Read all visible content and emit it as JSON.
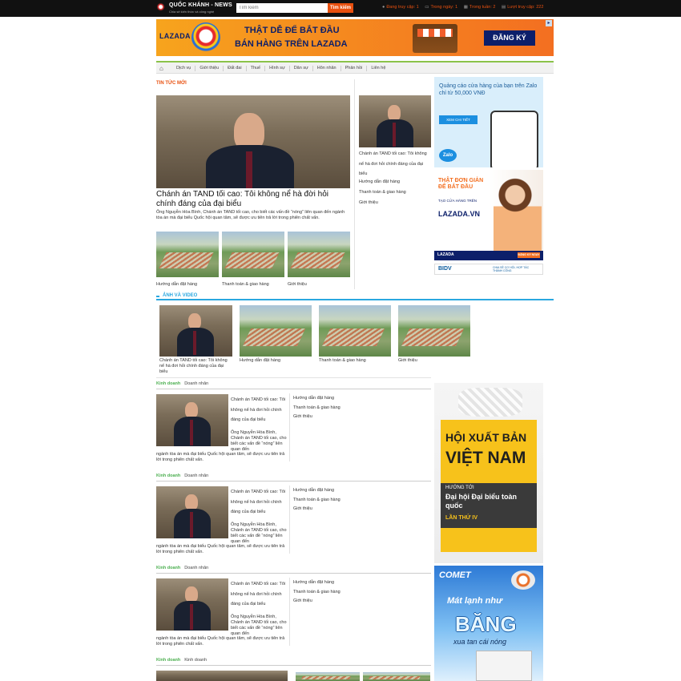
{
  "header": {
    "logo_name": "QUỐC KHÁNH - NEWS",
    "logo_tagline": "Chia sẻ kiến thức và công nghệ",
    "search_placeholder": "Tìm kiếm",
    "search_button": "Tìm kiếm",
    "stats": [
      {
        "label": "Đang truy cập:",
        "value": "1"
      },
      {
        "label": "Trong ngày:",
        "value": "1"
      },
      {
        "label": "Trong tuần:",
        "value": "2"
      },
      {
        "label": "Lượt truy cập:",
        "value": "222"
      }
    ]
  },
  "banner": {
    "brand": "LAZADA",
    "line1": "THẬT DỄ ĐỂ BẮT ĐẦU",
    "line2": "BÁN HÀNG TRÊN LAZADA",
    "cta": "ĐĂNG KÝ"
  },
  "nav": {
    "items": [
      "Dịch vụ",
      "Giới thiệu",
      "Đất đai",
      "Thuế",
      "Hình sự",
      "Dân sự",
      "Hôn nhân",
      "Phản hồi",
      "Liên hệ"
    ]
  },
  "latest": {
    "section_title": "TIN TỨC MỚI",
    "main_title": "Chánh án TAND tối cao: Tôi không nể hà đời hỏi chính đáng của đại biểu",
    "main_summary": "Ông Nguyễn Hòa Bình, Chánh án TAND tối cao, cho biết các vấn đề “nóng” liên quan đến ngành tòa án mà đại biểu Quốc hội quan tâm, sẽ được ưu tiên trả lời trong phiên chất vấn.",
    "thumbs": [
      "Hướng dẫn đặt hàng",
      "Thanh toán & giao hàng",
      "Giới thiệu"
    ],
    "side_caption": "Chánh án TAND tối cao: Tôi không nể hà đơi hỏi chính đáng của đại biểu",
    "side_links": [
      "Hướng dẫn đặt hàng",
      "Thanh toán & giao hàng",
      "Giới thiệu"
    ]
  },
  "video": {
    "section_title": "ẢNH VÀ VIDEO",
    "items": [
      "Chánh án TAND tối cao: Tôi không nể hà đơi hỏi chính đáng của đại biểu",
      "Hướng dẫn đặt hàng",
      "Thanh toán & giao hàng",
      "Giới thiệu"
    ]
  },
  "categories": [
    {
      "title": "Kinh doanh",
      "sub": "Doanh nhân"
    },
    {
      "title": "Kinh doanh",
      "sub": "Doanh nhân"
    },
    {
      "title": "Kinh doanh",
      "sub": "Doanh nhân"
    },
    {
      "title": "Kinh doanh",
      "sub": "Kinh doanh"
    }
  ],
  "category_block": {
    "title": "Chánh án TAND tối cao: Tôi không nể hà đơi hỏi chính đáng của đại biểu",
    "summary_short": "Ông Nguyễn Hòa Bình, Chánh án TAND tối cao, cho biết các vấn đề “nóng” liên quan đến",
    "summary_rest": "ngành tòa án mà đại biểu Quốc hội quan tâm, sẽ được ưu tiên trả lời trong phiên chất vấn.",
    "links": [
      "Hướng dẫn đặt hàng",
      "Thanh toán & giao hàng",
      "Giới thiệu"
    ]
  },
  "ads": {
    "zalo_text": "Quảng cáo cửa hàng của bạn trên Zalo chỉ từ 50,000 VNĐ",
    "zalo_button": "XEM CHI TIẾT",
    "zalo_logo": "Zalo",
    "lazada_t1": "THẬT ĐƠN GIẢN ĐỂ BẮT ĐẦU",
    "lazada_t2": "TẠO CỬA HÀNG TRÊN",
    "lazada_t3": "LAZADA.VN",
    "lazada_foot": "LAZADA",
    "lazada_cta": "ĐĂNG KÝ NGAY",
    "bidv": "BIDV",
    "bidv_sub": "CHIA SẺ CƠ HỘI, HỢP TÁC THÀNH CÔNG",
    "hxb_1": "HỘI XUẤT BẢN",
    "hxb_2": "VIỆT NAM",
    "hxb_3": "HƯỚNG TỚI",
    "hxb_4": "Đại hội Đại biểu toàn quốc",
    "hxb_5": "LẦN THỨ IV",
    "comet_brand": "COMET",
    "comet_slogan": "Mát lạnh như",
    "comet_big": "BĂNG",
    "comet_sub": "xua tan cái nóng"
  },
  "colors": {
    "accent": "#e8500f",
    "nav_border": "#8bc34a",
    "video_accent": "#2aa8e0",
    "category": "#4caf50"
  }
}
